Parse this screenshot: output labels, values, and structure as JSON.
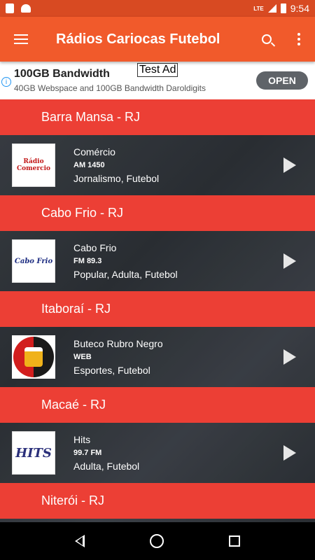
{
  "status_bar": {
    "network": "LTE",
    "time": "9:54"
  },
  "app_bar": {
    "title": "Rádios Cariocas Futebol"
  },
  "ad": {
    "headline": "100GB Bandwidth",
    "subtext": "40GB Webspace and 100GB Bandwidth Daroldigits",
    "label": "Test Ad",
    "cta": "OPEN"
  },
  "sections": [
    {
      "city": "Barra Mansa - RJ",
      "station": {
        "name": "Comércio",
        "freq": "AM 1450",
        "genre": "Jornalismo, Futebol",
        "logo": "Rádio Comercio"
      }
    },
    {
      "city": "Cabo Frio - RJ",
      "station": {
        "name": "Cabo Frio",
        "freq": "FM 89.3",
        "genre": "Popular, Adulta, Futebol",
        "logo": "Cabo Frio"
      }
    },
    {
      "city": "Itaboraí - RJ",
      "station": {
        "name": "Buteco Rubro Negro",
        "freq": "WEB",
        "genre": "Esportes, Futebol",
        "logo": ""
      }
    },
    {
      "city": "Macaé - RJ",
      "station": {
        "name": "Hits",
        "freq": "99.7 FM",
        "genre": "Adulta, Futebol",
        "logo": "HITS"
      }
    },
    {
      "city": "Niterói - RJ"
    }
  ],
  "colors": {
    "app_bar": "#f15a2b",
    "status_bar": "#d84a22",
    "section_header": "#ec3f35"
  },
  "icons": [
    "menu-icon",
    "search-icon",
    "more-vert-icon",
    "play-icon",
    "back-icon",
    "home-icon",
    "recents-icon"
  ]
}
